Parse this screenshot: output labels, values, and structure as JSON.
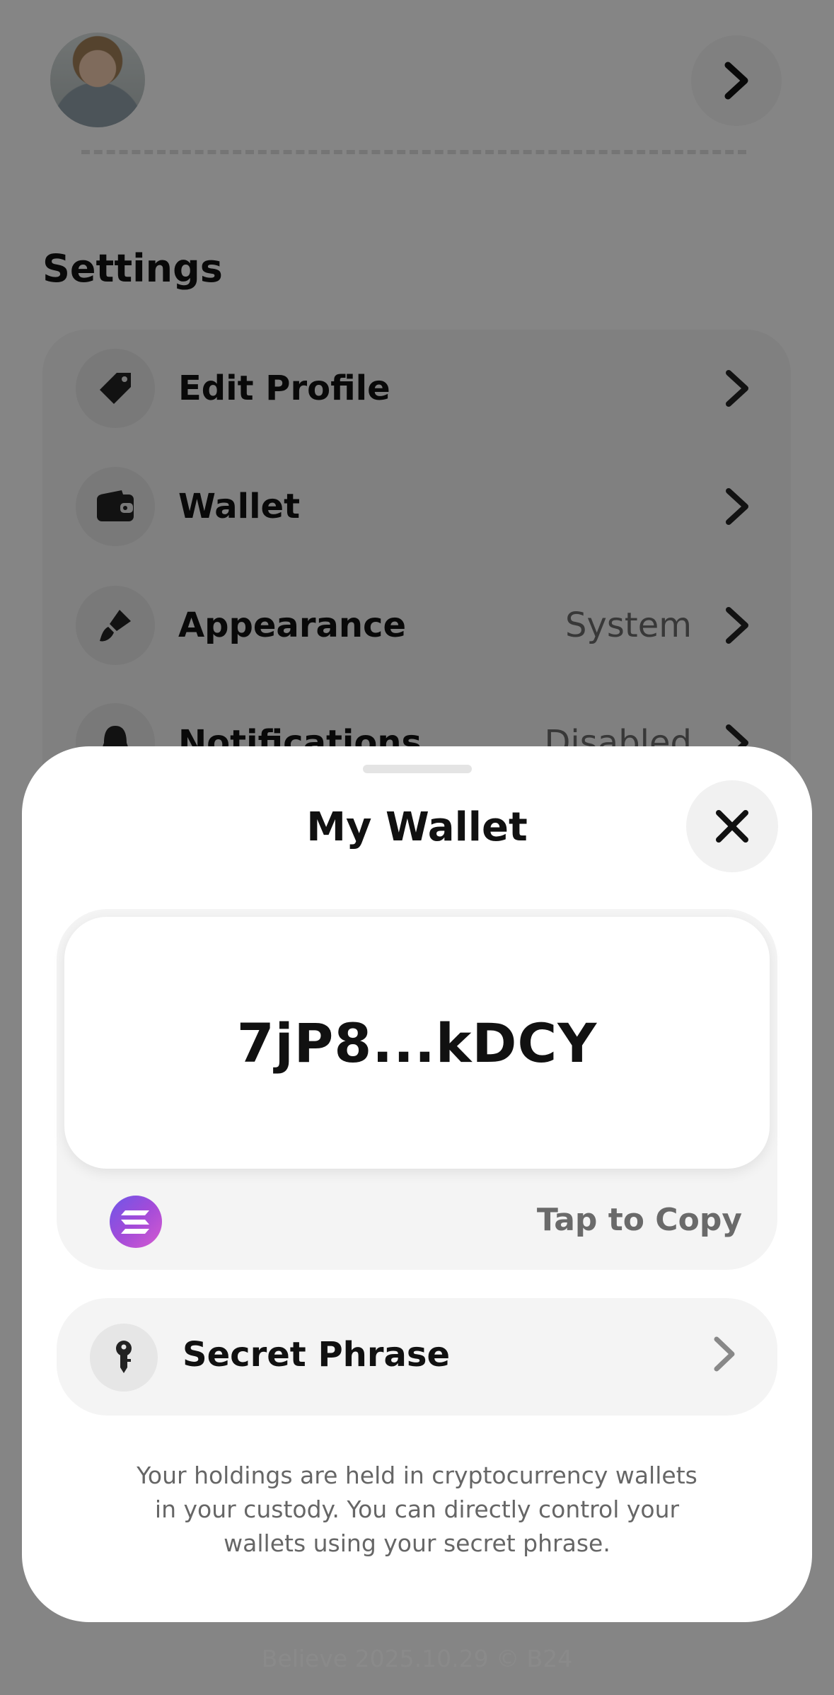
{
  "background": {
    "settings_title": "Settings",
    "items": [
      {
        "label": "Edit Profile",
        "value": "",
        "icon": "tag-icon"
      },
      {
        "label": "Wallet",
        "value": "",
        "icon": "wallet-icon"
      },
      {
        "label": "Appearance",
        "value": "System",
        "icon": "paintbrush-icon"
      },
      {
        "label": "Notifications",
        "value": "Disabled",
        "icon": "bell-icon"
      }
    ]
  },
  "sheet": {
    "title": "My Wallet",
    "address": "7jP8...kDCY",
    "address_network_icon": "solana-icon",
    "copy_label": "Tap to Copy",
    "secret_phrase_label": "Secret Phrase",
    "disclaimer": "Your holdings are held in cryptocurrency wallets in your custody. You can directly control your wallets using your secret phrase."
  },
  "footer": {
    "version_text": "Believe 2025.10.29 © B24"
  },
  "colors": {
    "overlay": "#000000",
    "sheet_bg": "#ffffff",
    "card_bg": "#f4f4f4",
    "solana_gradient_start": "#6d57e8",
    "solana_gradient_end": "#d65bd0"
  }
}
